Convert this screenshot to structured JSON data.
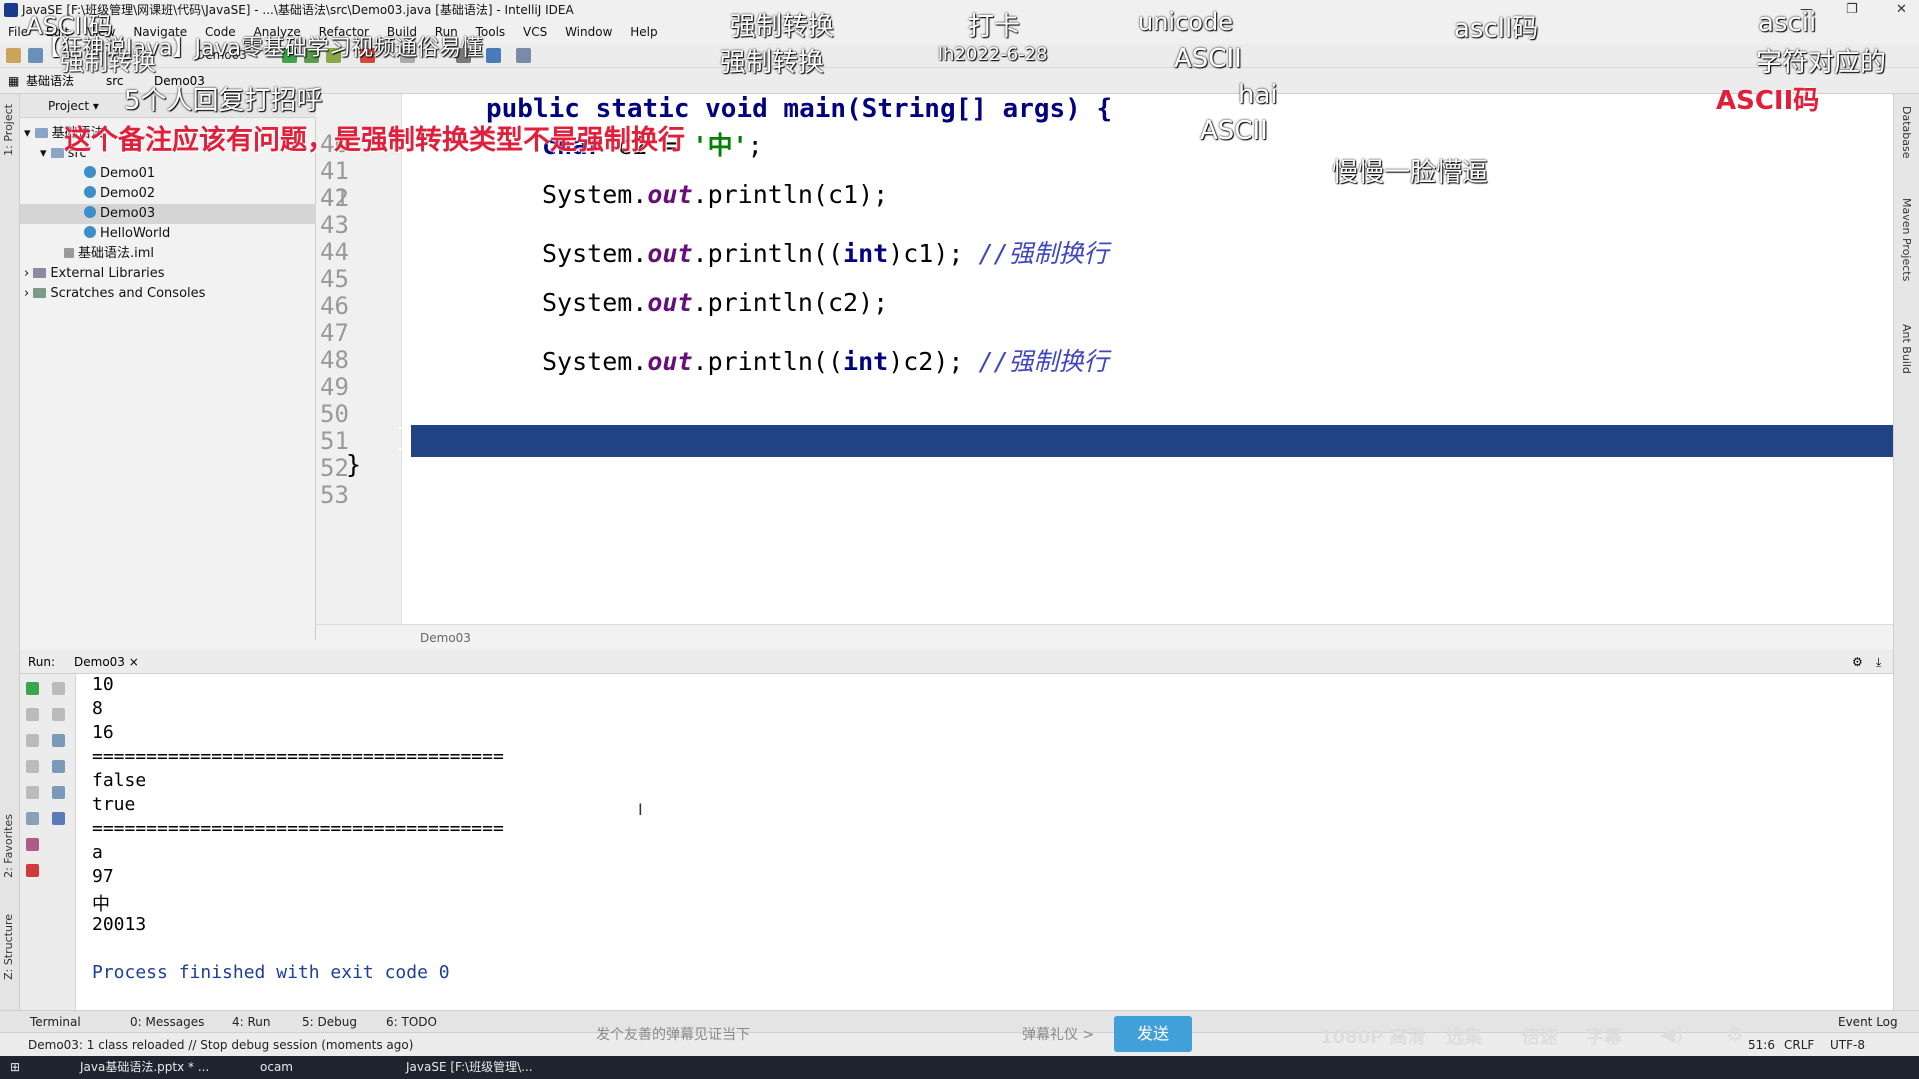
{
  "window": {
    "title": "JavaSE [F:\\班级管理\\网课班\\代码\\JavaSE] - ...\\基础语法\\src\\Demo03.java [基础语法] - IntelliJ IDEA",
    "controls": [
      "—",
      "❐",
      "✕"
    ]
  },
  "menubar": [
    "File",
    "Edit",
    "View",
    "Navigate",
    "Code",
    "Analyze",
    "Refactor",
    "Build",
    "Run",
    "Tools",
    "VCS",
    "Window",
    "Help"
  ],
  "toolbar": {
    "run_config": "Demo03"
  },
  "navbar": {
    "crumbs": [
      "基础语法",
      "src",
      "Demo03"
    ]
  },
  "left_stripe": {
    "project": "1: Project",
    "favorites": "2: Favorites",
    "structure": "Z: Structure"
  },
  "project_panel": {
    "header": "Project",
    "tree": [
      {
        "label": "基础语法",
        "kind": "module"
      },
      {
        "label": "src",
        "kind": "folder"
      },
      {
        "label": "Demo01",
        "kind": "class"
      },
      {
        "label": "Demo02",
        "kind": "class"
      },
      {
        "label": "Demo03",
        "kind": "class"
      },
      {
        "label": "HelloWorld",
        "kind": "class"
      },
      {
        "label": "基础语法.iml",
        "kind": "file"
      },
      {
        "label": "External Libraries",
        "kind": "lib"
      },
      {
        "label": "Scratches and Consoles",
        "kind": "lib"
      }
    ]
  },
  "editor": {
    "signature": "public static void main(String[] args) {",
    "line_numbers": [
      "40",
      "41",
      "42",
      "43",
      "44",
      "45",
      "46",
      "47",
      "48",
      "49",
      "50",
      "51",
      "52",
      "53"
    ],
    "char_decl": {
      "kw": "char",
      "rest": " c2 = ",
      "literal": "'中'",
      "end": ";"
    },
    "println_prefix": "System.",
    "out": "out",
    "println_c1": ".println(c1);",
    "println_c2": ".println(c2);",
    "cast_open": ".println((",
    "int_kw": "int",
    "cast_c1_end": ")c1); ",
    "cast_c2_end": ")c2); ",
    "comment": "//强制换行",
    "brace_close_inner": "}",
    "brace_close_outer": "}",
    "file_tab": "Demo03"
  },
  "run_panel": {
    "label": "Run:",
    "tab": "Demo03",
    "output": [
      "10",
      "8",
      "16",
      "======================================",
      "false",
      "true",
      "======================================",
      "a",
      "97",
      "中",
      "20013",
      "",
      "Process finished with exit code 0"
    ]
  },
  "right_stripe": [
    "Database",
    "Maven Projects",
    "Ant Build"
  ],
  "bottom_tabs": [
    "Terminal",
    "0: Messages",
    "4: Run",
    "5: Debug",
    "6: TODO",
    "Event Log"
  ],
  "status": {
    "message": "Demo03: 1 class reloaded // Stop debug session (moments ago)",
    "position": "51:6",
    "line_sep": "CRLF",
    "encoding": "UTF-8"
  },
  "player": {
    "placeholder": "发个友善的弹幕见证当下",
    "etiquette": "弹幕礼仪 >",
    "send": "发送",
    "quality": "1080P 高清",
    "select": "选集",
    "speed": "倍速",
    "subtitle": "字幕"
  },
  "taskbar": [
    "Java基础语法.pptx * ...",
    "ocam",
    "JavaSE [F:\\班级管理\\..."
  ],
  "danmaku": {
    "title": "【狂神说Java】Java零基础学习视频通俗易懂",
    "white": [
      "ASCII码",
      "强制转换",
      "5个人回复打招呼",
      "强制转换",
      "打卡",
      "unicode",
      "ascll码",
      "ascii",
      "强制转换",
      "lh2022-6-28",
      "ASCII",
      "字符对应的",
      "hai",
      "ASCII",
      "慢慢一脸懵逼"
    ],
    "red": [
      "这个备注应该有问题，是强制转换类型不是强制换行",
      "ASCII码"
    ]
  }
}
